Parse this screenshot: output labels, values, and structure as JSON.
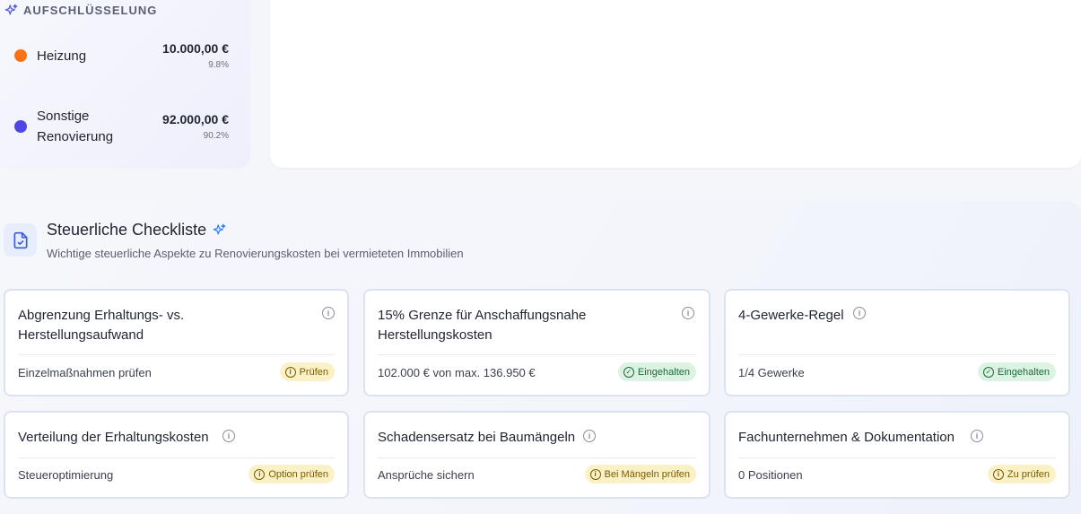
{
  "breakdown": {
    "title": "AUFSCHLÜSSELUNG",
    "items": [
      {
        "label": "Heizung",
        "amount": "10.000,00 €",
        "percent": "9.8%",
        "color": "#f97316"
      },
      {
        "label": "Sonstige Renovierung",
        "amount": "92.000,00 €",
        "percent": "90.2%",
        "color": "#4f46e5"
      }
    ]
  },
  "checklist": {
    "title": "Steuerliche Checkliste",
    "subtitle": "Wichtige steuerliche Aspekte zu Renovierungskosten bei vermieteten Immobilien",
    "cards": [
      {
        "title": "Abgrenzung Erhaltungs- vs. Herstellungsaufwand",
        "meta": "Einzelmaßnahmen prüfen",
        "status": "Prüfen",
        "status_type": "warn"
      },
      {
        "title": "15% Grenze für Anschaffungsnahe Herstellungskosten",
        "meta": "102.000 € von max. 136.950 €",
        "status": "Eingehalten",
        "status_type": "ok"
      },
      {
        "title": "4-Gewerke-Regel",
        "meta": "1/4 Gewerke",
        "status": "Eingehalten",
        "status_type": "ok"
      },
      {
        "title": "Verteilung der Erhaltungskosten",
        "meta": "Steueroptimierung",
        "status": "Option prüfen",
        "status_type": "warn"
      },
      {
        "title": "Schadensersatz bei Baumängeln",
        "meta": "Ansprüche sichern",
        "status": "Bei Mängeln prüfen",
        "status_type": "warn"
      },
      {
        "title": "Fachunternehmen & Dokumentation",
        "meta": "0 Positionen",
        "status": "Zu prüfen",
        "status_type": "warn"
      }
    ]
  },
  "colors": {
    "accent": "#4f46e5",
    "warn_bg": "#fbf1c6",
    "ok_bg": "#dcf3e4"
  }
}
